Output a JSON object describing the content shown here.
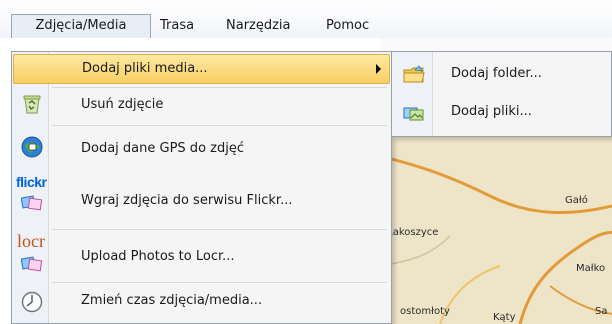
{
  "menubar": {
    "items": [
      {
        "label": "Zdjęcia/Media"
      },
      {
        "label": "Trasa"
      },
      {
        "label": "Narzędzia"
      },
      {
        "label": "Pomoc"
      }
    ]
  },
  "dropdown": {
    "items": [
      {
        "label": "Dodaj pliki media...",
        "icon": "none",
        "has_submenu": true
      },
      {
        "label": "Usuń zdjęcie",
        "icon": "recycle-bin-icon"
      },
      {
        "label": "Dodaj dane GPS do zdjęć",
        "icon": "gps-globe-icon"
      },
      {
        "label": "Wgraj zdjęcia do serwisu Flickr...",
        "icon": "flickr-icon"
      },
      {
        "label": "Upload Photos to Locr...",
        "icon": "locr-icon"
      },
      {
        "label": "Zmień czas zdjęcia/media...",
        "icon": "clock-icon"
      }
    ]
  },
  "submenu": {
    "items": [
      {
        "label": "Dodaj folder...",
        "icon": "folder-icon"
      },
      {
        "label": "Dodaj pliki...",
        "icon": "files-icon"
      }
    ]
  },
  "icons": {
    "flickr_text": "flickr",
    "locr_text": "locr"
  },
  "map": {
    "labels": [
      "Gałó",
      "Rakoszyce",
      "Małko",
      "ostomłoty",
      "Kąty",
      "Sa"
    ]
  },
  "colors": {
    "highlight": "#f9cf63",
    "map_background": "#eee5c9",
    "road": "#e39b3a"
  }
}
